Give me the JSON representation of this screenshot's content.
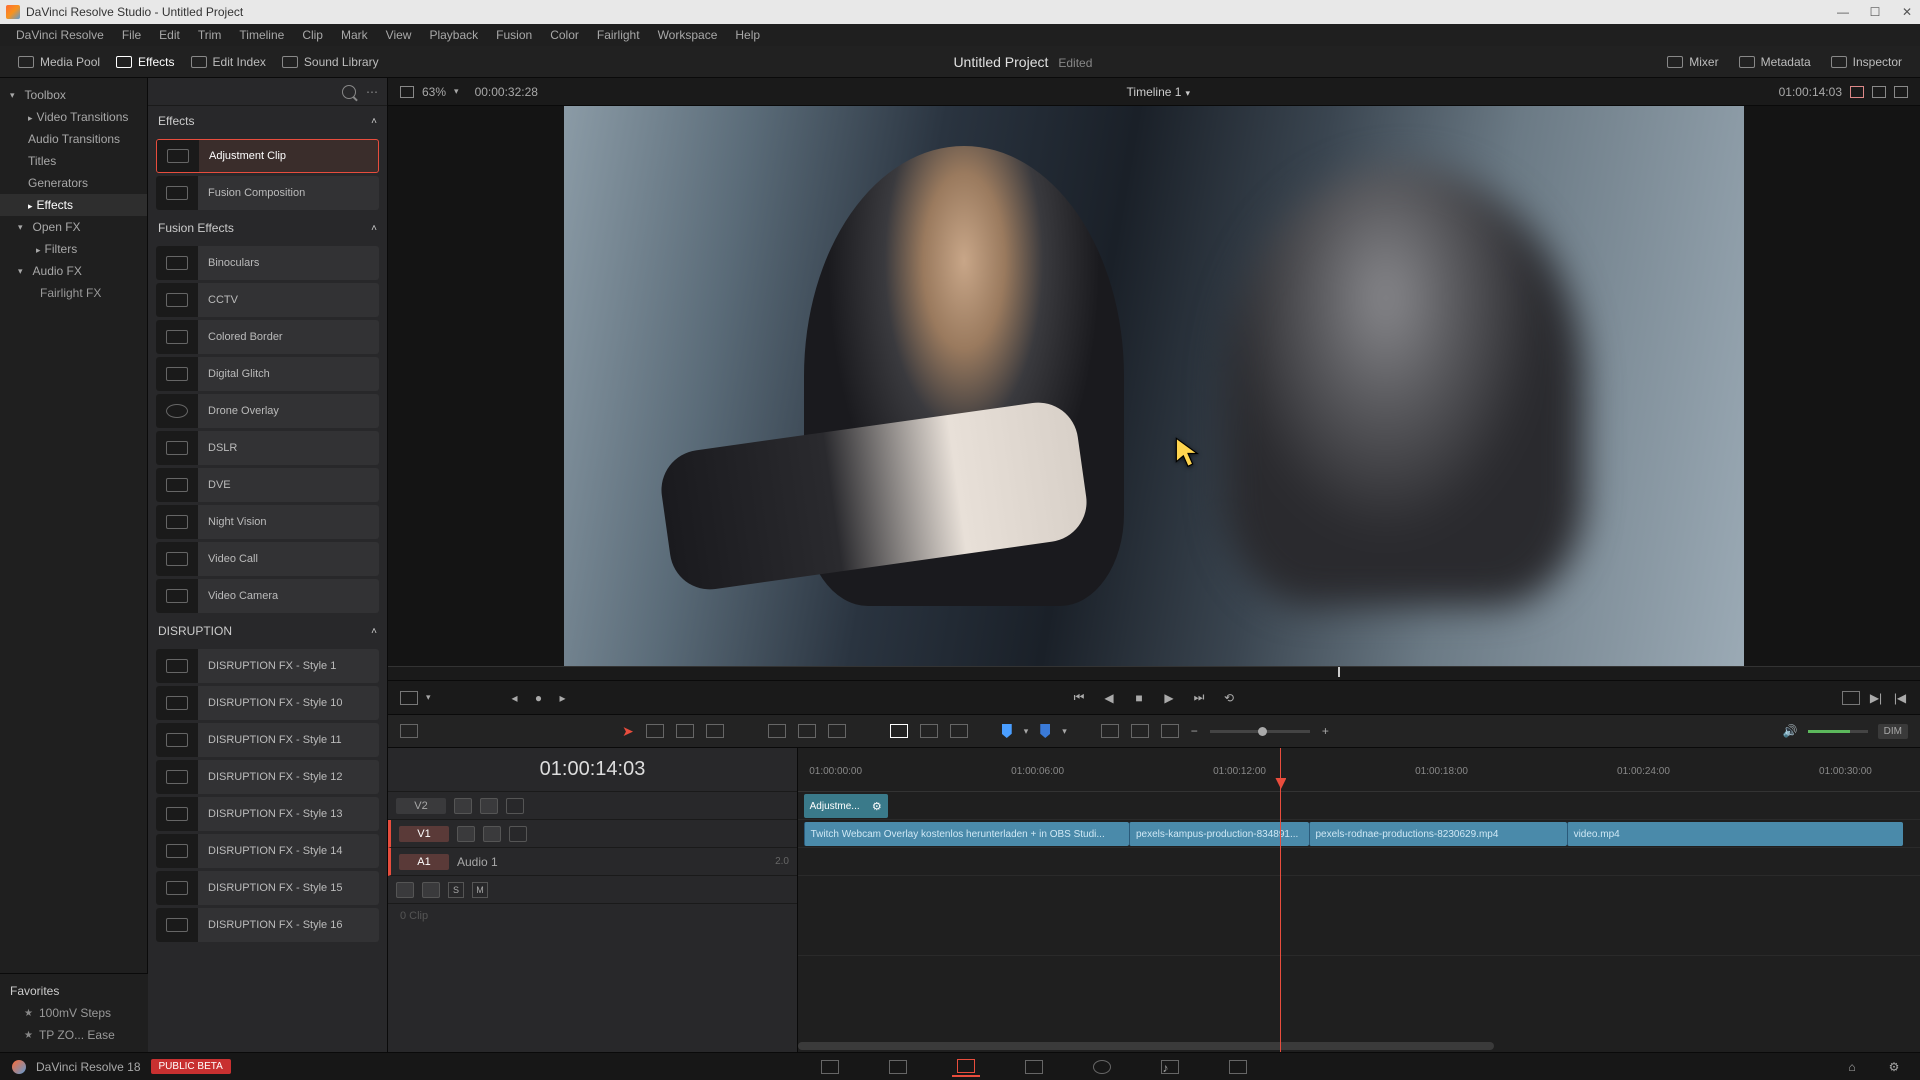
{
  "window": {
    "title": "DaVinci Resolve Studio - Untitled Project"
  },
  "menubar": [
    "DaVinci Resolve",
    "File",
    "Edit",
    "Trim",
    "Timeline",
    "Clip",
    "Mark",
    "View",
    "Playback",
    "Fusion",
    "Color",
    "Fairlight",
    "Workspace",
    "Help"
  ],
  "secondbar": {
    "media_pool": "Media Pool",
    "effects": "Effects",
    "edit_index": "Edit Index",
    "sound_library": "Sound Library",
    "project": "Untitled Project",
    "edited": "Edited",
    "mixer": "Mixer",
    "metadata": "Metadata",
    "inspector": "Inspector"
  },
  "viewerbar": {
    "zoom": "63%",
    "src_tc": "00:00:32:28",
    "timeline_name": "Timeline 1",
    "rec_tc": "01:00:14:03"
  },
  "toolbox": {
    "root": "Toolbox",
    "items": [
      "Video Transitions",
      "Audio Transitions",
      "Titles",
      "Generators",
      "Effects"
    ],
    "open_fx": "Open FX",
    "filters": "Filters",
    "audio_fx": "Audio FX",
    "fairlight_fx": "Fairlight FX"
  },
  "effects_panel": {
    "section_effects": "Effects",
    "adjustment_clip": "Adjustment Clip",
    "fusion_composition": "Fusion Composition",
    "section_fusion": "Fusion Effects",
    "fusion_list": [
      "Binoculars",
      "CCTV",
      "Colored Border",
      "Digital Glitch",
      "Drone Overlay",
      "DSLR",
      "DVE",
      "Night Vision",
      "Video Call",
      "Video Camera"
    ],
    "section_disruption": "DISRUPTION",
    "disruption_list": [
      "DISRUPTION FX - Style 1",
      "DISRUPTION FX - Style 10",
      "DISRUPTION FX - Style 11",
      "DISRUPTION FX - Style 12",
      "DISRUPTION FX - Style 13",
      "DISRUPTION FX - Style 14",
      "DISRUPTION FX - Style 15",
      "DISRUPTION FX - Style 16"
    ]
  },
  "favorites": {
    "header": "Favorites",
    "items": [
      "100mV Steps",
      "TP ZO... Ease"
    ]
  },
  "timeline": {
    "big_tc": "01:00:14:03",
    "ruler": [
      "01:00:00:00",
      "01:00:06:00",
      "01:00:12:00",
      "01:00:18:00",
      "01:00:24:00",
      "01:00:30:00"
    ],
    "track_v2": "V2",
    "track_v1": "V1",
    "track_a1": "A1",
    "audio1_name": "Audio 1",
    "audio1_level": "2.0",
    "audio_ph": "0 Clip",
    "clips": {
      "adj": "Adjustme...",
      "c1": "Twitch Webcam Overlay kostenlos herunterladen + in OBS Studi...",
      "c2": "pexels-kampus-production-834891...",
      "c3": "pexels-rodnae-productions-8230629.mp4",
      "c4": "video.mp4"
    },
    "s_label": "S",
    "m_label": "M"
  },
  "toolbar": {
    "dim": "DIM"
  },
  "bottombar": {
    "product": "DaVinci Resolve 18",
    "badge": "PUBLIC BETA"
  }
}
